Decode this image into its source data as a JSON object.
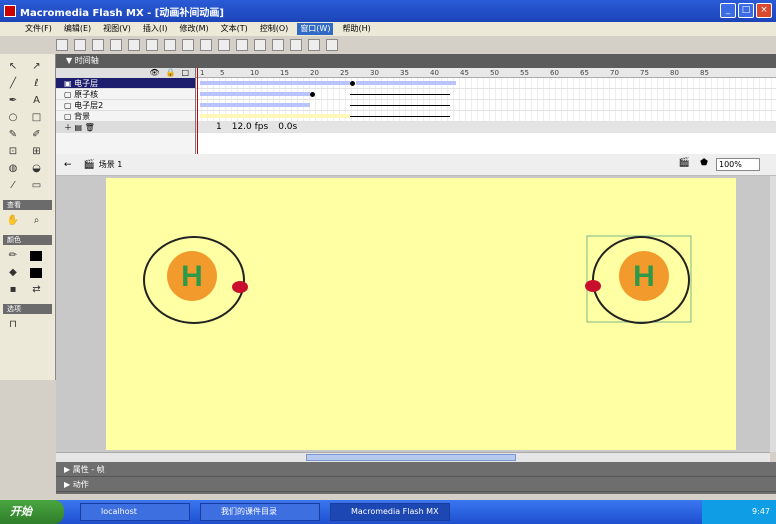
{
  "window": {
    "title": "Macromedia Flash MX - [动画补间动画]"
  },
  "menu": {
    "items": [
      "文件(F)",
      "编辑(E)",
      "视图(V)",
      "插入(I)",
      "修改(M)",
      "文本(T)",
      "控制(O)",
      "窗口(W)",
      "帮助(H)"
    ]
  },
  "timeline": {
    "header": "▼ 时间轴",
    "layers": [
      {
        "name": "电子层",
        "selected": true
      },
      {
        "name": "原子核",
        "selected": false
      },
      {
        "name": "电子层2",
        "selected": false
      },
      {
        "name": "背景",
        "selected": false
      }
    ],
    "ruler": [
      "1",
      "5",
      "10",
      "15",
      "20",
      "25",
      "30",
      "35",
      "40",
      "45",
      "50",
      "55",
      "60",
      "65",
      "70",
      "75",
      "80",
      "85"
    ],
    "status": {
      "frame": "1",
      "fps": "12.0 fps",
      "time": "0.0s"
    }
  },
  "docbar": {
    "scene": "场景 1",
    "zoom": "100%"
  },
  "tools": {
    "groups": [
      "查看",
      "颜色",
      "选项"
    ]
  },
  "stage": {
    "atoms": [
      {
        "label": "H",
        "selected": false
      },
      {
        "label": "H",
        "selected": true
      }
    ]
  },
  "panels": {
    "rows": [
      "▶ 属性 - 帧",
      "▶ 动作"
    ]
  },
  "taskbar": {
    "start": "开始",
    "tasks": [
      "localhost",
      "我们的课件目录",
      "Macromedia Flash MX"
    ],
    "tray": "9:47"
  },
  "colors": {
    "stage": "#ffffa3",
    "nucleus": "#f29b2c",
    "h_letter": "#2e9a49",
    "electron": "#c8102e"
  }
}
